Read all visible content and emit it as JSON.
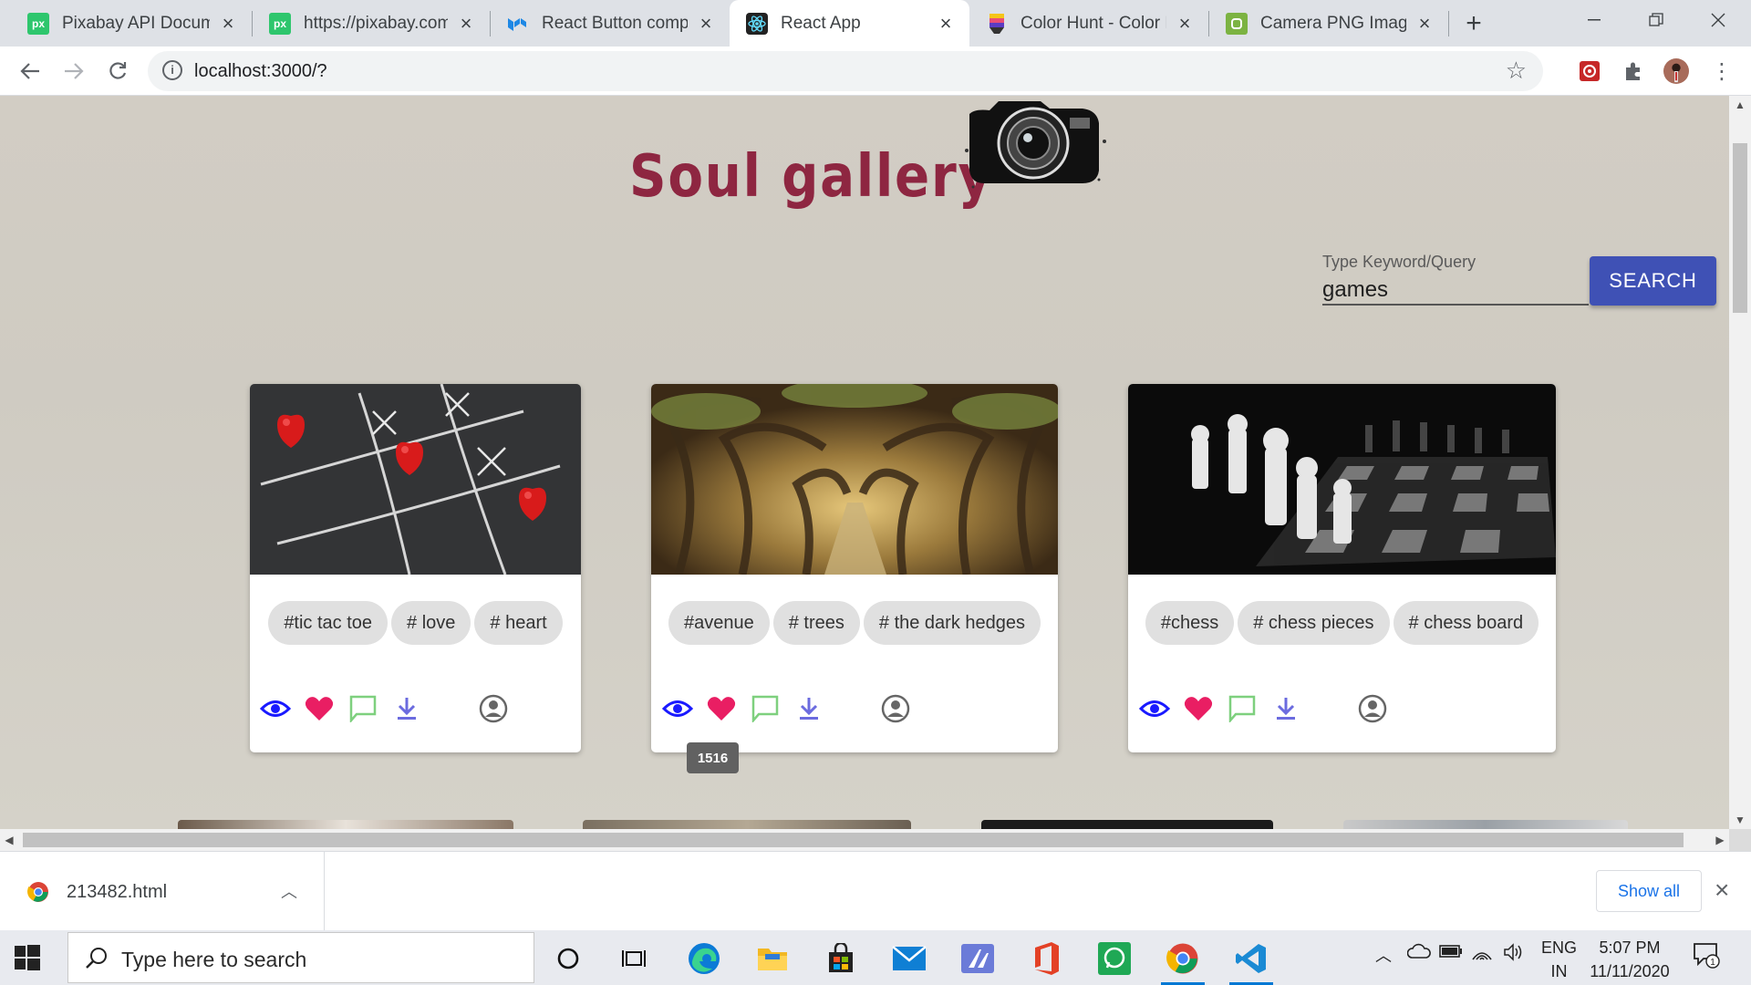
{
  "browser": {
    "tabs": [
      {
        "title": "Pixabay API Documentation",
        "icon": "pixabay-icon",
        "active": false
      },
      {
        "title": "https://pixabay.com/",
        "icon": "pixabay-icon",
        "active": false
      },
      {
        "title": "React Button component",
        "icon": "mui-icon",
        "active": false
      },
      {
        "title": "React App",
        "icon": "react-icon",
        "active": true
      },
      {
        "title": "Color Hunt - Color Palettes",
        "icon": "colorhunt-icon",
        "active": false
      },
      {
        "title": "Camera PNG Images",
        "icon": "pngtree-icon",
        "active": false
      }
    ],
    "url": "localhost:3000/?"
  },
  "page": {
    "brand": "Soul gallery",
    "search": {
      "label": "Type Keyword/Query",
      "value": "games",
      "button": "SEARCH"
    },
    "cards": [
      {
        "tags": [
          "#tic tac toe",
          "# love",
          "# heart"
        ],
        "image": "tic-tac-toe hearts on chalkboard"
      },
      {
        "tags": [
          "#avenue",
          "# trees",
          "# the dark hedges"
        ],
        "image": "dark hedges tree avenue"
      },
      {
        "tags": [
          "#chess",
          "# chess pieces",
          "# chess board"
        ],
        "image": "black and white chess board"
      }
    ],
    "tooltip": "1516"
  },
  "downloads": {
    "file": "213482.html",
    "show_all": "Show all"
  },
  "taskbar": {
    "search_placeholder": "Type here to search",
    "lang_line1": "ENG",
    "lang_line2": "IN",
    "time": "5:07 PM",
    "date": "11/11/2020",
    "notifications": "1"
  },
  "colors": {
    "brand": "#8e2641",
    "accent": "#3f51b5",
    "view": "#1a1aff",
    "like": "#e91e63",
    "comment": "#7ed07e",
    "download": "#6b6bdf"
  }
}
